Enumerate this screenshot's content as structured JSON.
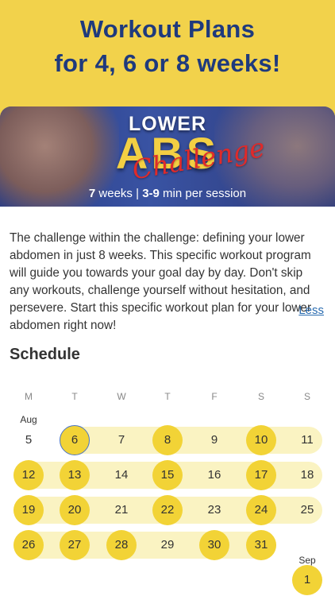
{
  "promo": {
    "line1": "Workout Plans",
    "line2": "for 4, 6 or 8 weeks!"
  },
  "banner": {
    "title_lower": "LOWER",
    "title_abs": "ABS",
    "title_script": "Challenge",
    "weeks": "7",
    "weeks_label": "weeks",
    "separator": "|",
    "minutes": "3-9",
    "minutes_label": "min per session"
  },
  "description": {
    "text": "The challenge within the challenge: defining your lower abdomen in just 8 weeks. This specific workout program will guide you towards your goal day by day. Don't skip any workouts, challenge yourself without hesitation, and persevere. Start this specific workout plan for your lower abdomen right now!",
    "less_link": "Less"
  },
  "schedule": {
    "title": "Schedule",
    "weekdays": [
      "M",
      "T",
      "W",
      "T",
      "F",
      "S",
      "S"
    ],
    "month_aug": "Aug",
    "month_sep": "Sep",
    "rows": [
      [
        {
          "day": "5",
          "workout": false,
          "today": false
        },
        {
          "day": "6",
          "workout": true,
          "today": true
        },
        {
          "day": "7",
          "workout": false,
          "today": false
        },
        {
          "day": "8",
          "workout": true,
          "today": false
        },
        {
          "day": "9",
          "workout": false,
          "today": false
        },
        {
          "day": "10",
          "workout": true,
          "today": false
        },
        {
          "day": "11",
          "workout": false,
          "today": false
        }
      ],
      [
        {
          "day": "12",
          "workout": true,
          "today": false
        },
        {
          "day": "13",
          "workout": true,
          "today": false
        },
        {
          "day": "14",
          "workout": false,
          "today": false
        },
        {
          "day": "15",
          "workout": true,
          "today": false
        },
        {
          "day": "16",
          "workout": false,
          "today": false
        },
        {
          "day": "17",
          "workout": true,
          "today": false
        },
        {
          "day": "18",
          "workout": false,
          "today": false
        }
      ],
      [
        {
          "day": "19",
          "workout": true,
          "today": false
        },
        {
          "day": "20",
          "workout": true,
          "today": false
        },
        {
          "day": "21",
          "workout": false,
          "today": false
        },
        {
          "day": "22",
          "workout": true,
          "today": false
        },
        {
          "day": "23",
          "workout": false,
          "today": false
        },
        {
          "day": "24",
          "workout": true,
          "today": false
        },
        {
          "day": "25",
          "workout": false,
          "today": false
        }
      ],
      [
        {
          "day": "26",
          "workout": true,
          "today": false
        },
        {
          "day": "27",
          "workout": true,
          "today": false
        },
        {
          "day": "28",
          "workout": true,
          "today": false
        },
        {
          "day": "29",
          "workout": false,
          "today": false
        },
        {
          "day": "30",
          "workout": true,
          "today": false
        },
        {
          "day": "31",
          "workout": true,
          "today": false
        }
      ]
    ],
    "sep_first": {
      "day": "1",
      "workout": true,
      "today": false
    }
  },
  "colors": {
    "promo_bg": "#f2d24b",
    "promo_text": "#1f3a7d",
    "workout_day": "#f2d336",
    "track": "#faf3c2",
    "today_ring": "#4a74c4",
    "link": "#2b6cb0"
  }
}
